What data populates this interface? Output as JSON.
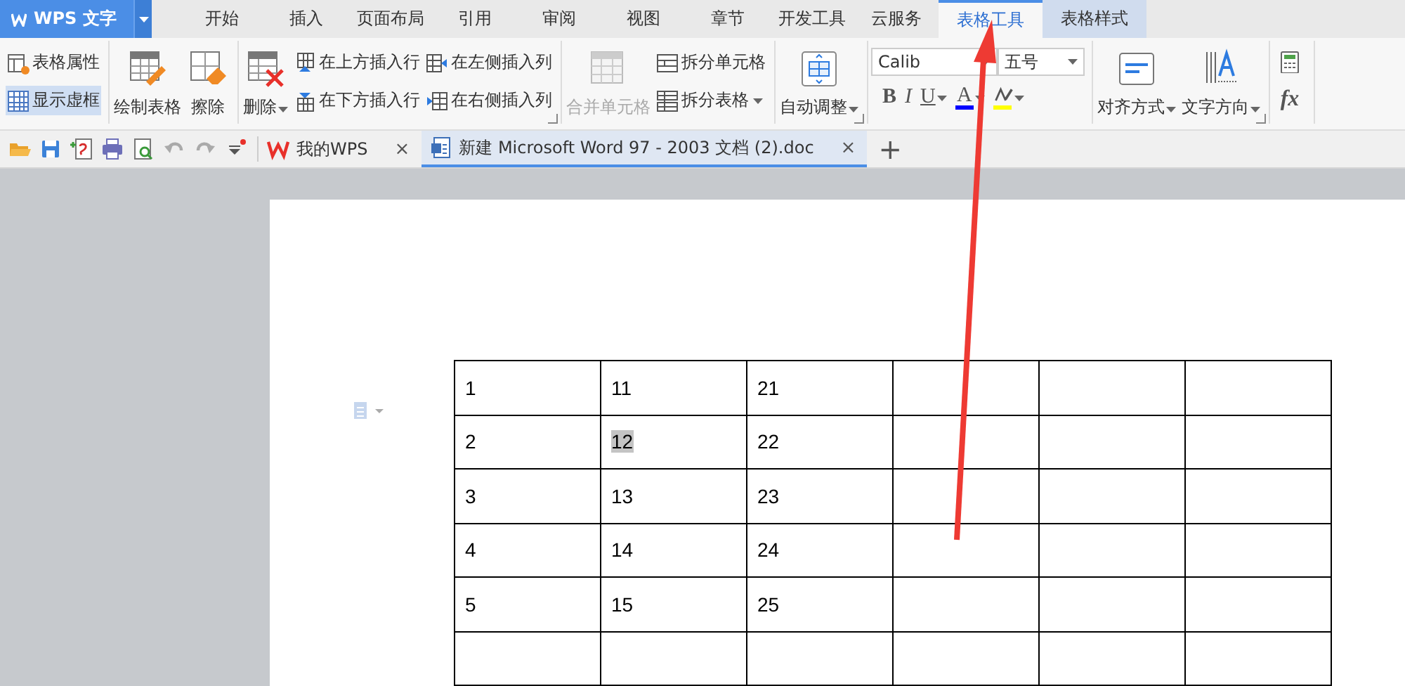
{
  "app_menu": {
    "label": "WPS 文字"
  },
  "tabs": [
    {
      "label": "开始",
      "selected": false,
      "contextual": false
    },
    {
      "label": "插入",
      "selected": false,
      "contextual": false
    },
    {
      "label": "页面布局",
      "selected": false,
      "contextual": false
    },
    {
      "label": "引用",
      "selected": false,
      "contextual": false
    },
    {
      "label": "审阅",
      "selected": false,
      "contextual": false
    },
    {
      "label": "视图",
      "selected": false,
      "contextual": false
    },
    {
      "label": "章节",
      "selected": false,
      "contextual": false
    },
    {
      "label": "开发工具",
      "selected": false,
      "contextual": false
    },
    {
      "label": "云服务",
      "selected": false,
      "contextual": false
    },
    {
      "label": "表格工具",
      "selected": true,
      "contextual": true
    },
    {
      "label": "表格样式",
      "selected": false,
      "contextual": true
    }
  ],
  "ribbon": [
    {
      "launcher": false,
      "controls": [
        {
          "kind": "stack",
          "items": [
            {
              "label": "表格属性",
              "on": false,
              "dropdown": false
            },
            {
              "label": "显示虚框",
              "on": true,
              "dropdown": false
            }
          ]
        }
      ]
    },
    {
      "launcher": false,
      "controls": [
        {
          "kind": "large",
          "label": "绘制表格",
          "dropdown": false,
          "disabled": false
        },
        {
          "kind": "large",
          "label": "擦除",
          "dropdown": false,
          "disabled": false
        }
      ]
    },
    {
      "launcher": true,
      "controls": [
        {
          "kind": "large",
          "label": "删除",
          "dropdown": true,
          "disabled": false
        },
        {
          "kind": "stack",
          "items": [
            {
              "label": "在上方插入行",
              "on": false,
              "dropdown": false
            },
            {
              "label": "在下方插入行",
              "on": false,
              "dropdown": false
            }
          ]
        },
        {
          "kind": "stack",
          "items": [
            {
              "label": "在左侧插入列",
              "on": false,
              "dropdown": false
            },
            {
              "label": "在右侧插入列",
              "on": false,
              "dropdown": false
            }
          ]
        }
      ]
    },
    {
      "launcher": false,
      "controls": [
        {
          "kind": "large",
          "label": "合并单元格",
          "dropdown": false,
          "disabled": true
        },
        {
          "kind": "stack",
          "items": [
            {
              "label": "拆分单元格",
              "on": false,
              "dropdown": false
            },
            {
              "label": "拆分表格",
              "on": false,
              "dropdown": true
            }
          ]
        }
      ]
    },
    {
      "launcher": true,
      "controls": [
        {
          "kind": "large",
          "label": "自动调整",
          "dropdown": true,
          "disabled": false
        }
      ]
    },
    {
      "launcher": false,
      "controls": [
        {
          "kind": "font",
          "font": "Calib",
          "size": "五号",
          "styles": [
            {
              "kind": "bold",
              "label": "B",
              "dropdown": false
            },
            {
              "kind": "italic",
              "label": "I",
              "dropdown": false
            },
            {
              "kind": "underline",
              "label": "U",
              "dropdown": true
            },
            {
              "kind": "color",
              "label": "A",
              "dropdown": true,
              "color": "#0000ff"
            },
            {
              "kind": "highlight",
              "dropdown": true,
              "color": "#ffff00"
            }
          ]
        }
      ]
    },
    {
      "launcher": true,
      "controls": [
        {
          "kind": "large",
          "label": "对齐方式",
          "dropdown": true,
          "disabled": false
        },
        {
          "kind": "large",
          "label": "文字方向",
          "dropdown": true,
          "disabled": false
        }
      ]
    },
    {
      "launcher": false,
      "controls": [
        {
          "kind": "formula",
          "label": "fx"
        }
      ]
    }
  ],
  "doc_tabs": [
    {
      "label": "我的WPS",
      "selected": false,
      "kind": "home",
      "close": "×"
    },
    {
      "label": "新建 Microsoft Word 97 - 2003 文档 (2).doc",
      "selected": true,
      "kind": "doc",
      "close": "×"
    }
  ],
  "new_tab": "+",
  "table": {
    "rows": [
      {
        "cells": [
          {
            "text": "1",
            "selected": false
          },
          {
            "text": "11",
            "selected": false
          },
          {
            "text": "21",
            "selected": false
          },
          {},
          {},
          {}
        ]
      },
      {
        "cells": [
          {
            "text": "2",
            "selected": false
          },
          {
            "text": "12",
            "selected": true
          },
          {
            "text": "22",
            "selected": false
          },
          {},
          {},
          {}
        ]
      },
      {
        "cells": [
          {
            "text": "3",
            "selected": false
          },
          {
            "text": "13",
            "selected": false
          },
          {
            "text": "23",
            "selected": false
          },
          {},
          {},
          {}
        ]
      },
      {
        "cells": [
          {
            "text": "4",
            "selected": false
          },
          {
            "text": "14",
            "selected": false
          },
          {
            "text": "24",
            "selected": false
          },
          {},
          {},
          {}
        ]
      },
      {
        "cells": [
          {
            "text": "5",
            "selected": false
          },
          {
            "text": "15",
            "selected": false
          },
          {
            "text": "25",
            "selected": false
          },
          {},
          {},
          {}
        ]
      },
      {
        "cells": [
          {},
          {},
          {},
          {},
          {},
          {}
        ]
      }
    ]
  }
}
